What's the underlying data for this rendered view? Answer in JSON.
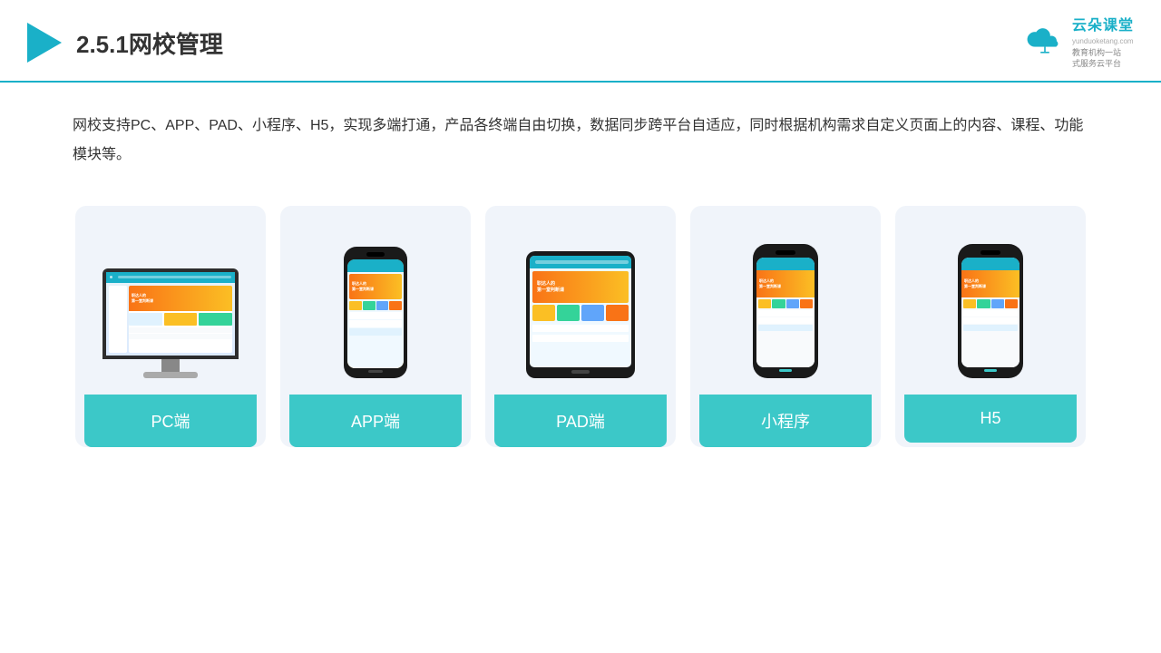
{
  "header": {
    "title": "2.5.1网校管理",
    "brand_name": "云朵课堂",
    "brand_url": "yunduoketang.com",
    "brand_slogan_line1": "教育机构一站",
    "brand_slogan_line2": "式服务云平台"
  },
  "description": {
    "text": "网校支持PC、APP、PAD、小程序、H5，实现多端打通，产品各终端自由切换，数据同步跨平台自适应，同时根据机构需求自定义页面上的内容、课程、功能模块等。"
  },
  "cards": [
    {
      "id": "pc",
      "label": "PC端"
    },
    {
      "id": "app",
      "label": "APP端"
    },
    {
      "id": "pad",
      "label": "PAD端"
    },
    {
      "id": "miniapp",
      "label": "小程序"
    },
    {
      "id": "h5",
      "label": "H5"
    }
  ],
  "colors": {
    "accent": "#3cc8c8",
    "header_line": "#1ab0c8",
    "card_bg": "#f0f4fa",
    "text_main": "#333333"
  }
}
